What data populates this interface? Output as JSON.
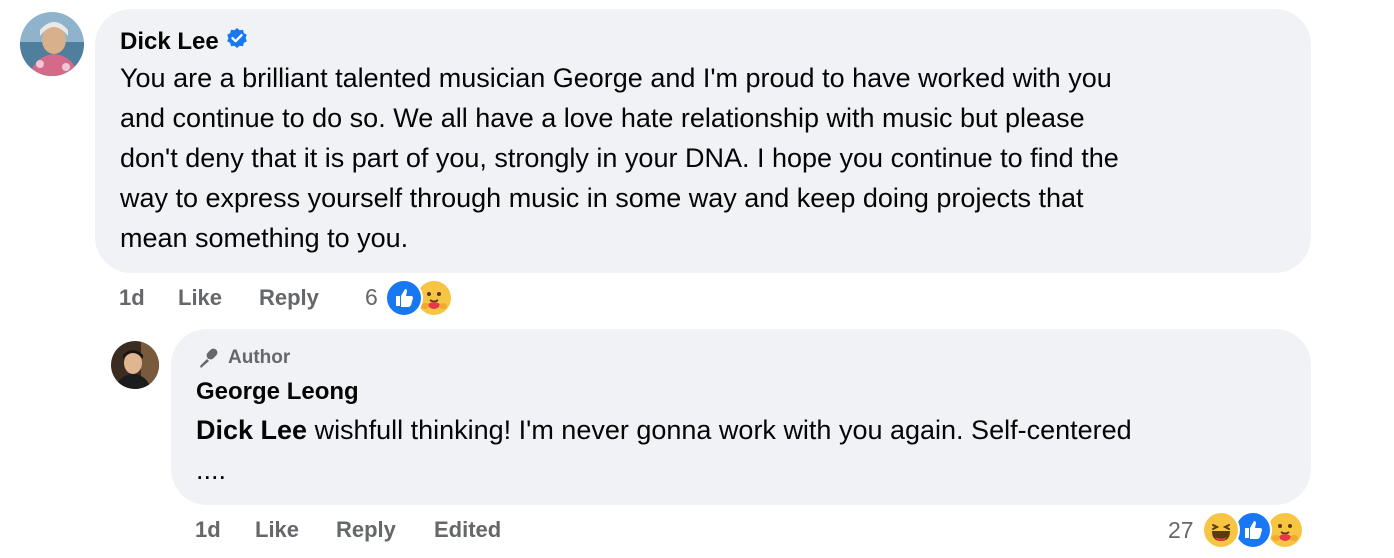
{
  "comment": {
    "author": "Dick Lee",
    "verified_icon": "verified-badge-icon",
    "lines": [
      "You are a brilliant talented musician George and I'm proud to have worked with you",
      "and continue to do so. We all have a love hate relationship with music but please",
      "don't deny that it is part of you, strongly in your DNA. I hope you continue to find the",
      "way to express yourself through music in some way and keep doing projects that",
      "mean something to you."
    ],
    "time": "1d",
    "like_label": "Like",
    "reply_label": "Reply",
    "reaction_count": "6",
    "reactions": [
      "like-reaction-icon",
      "care-reaction-icon"
    ]
  },
  "reply": {
    "badge": "Author",
    "badge_icon": "microphone-icon",
    "author": "George Leong",
    "mention": "Dick Lee",
    "line1": " wishfull thinking! I'm never gonna work with you again. Self-centered",
    "line2": "....",
    "time": "1d",
    "like_label": "Like",
    "reply_label": "Reply",
    "edited_label": "Edited",
    "reaction_count": "27",
    "reactions": [
      "haha-reaction-icon",
      "like-reaction-icon",
      "care-reaction-icon"
    ]
  },
  "colors": {
    "bubble": "#f0f2f5",
    "meta_text": "#65676b",
    "like_blue": "#1877f2",
    "verified_blue": "#1877f2"
  }
}
